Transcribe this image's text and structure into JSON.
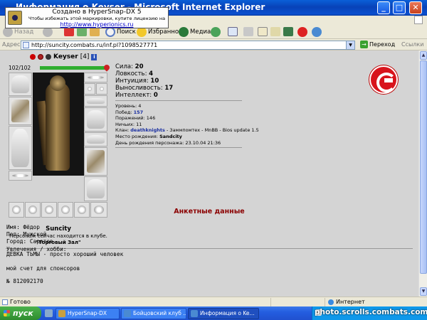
{
  "window": {
    "title": "Информация о Keyser - Microsoft Internet Explorer",
    "minimize": "_",
    "maximize": "□",
    "close": "✕"
  },
  "watermark": {
    "line1": "Создано в HyperSnap-DX 5",
    "line2": "Чтобы избежать этой маркировки, купите лицензию на",
    "line3": "http://www.hyperionics.ru"
  },
  "toolbar": {
    "back": "Назад",
    "search": "Поиск",
    "favorites": "Избранное",
    "media": "Медиа"
  },
  "address": {
    "label": "Адрес:",
    "url": "http://suncity.combats.ru/inf.pl?1098527771",
    "go": "Переход",
    "links": "Ссылки"
  },
  "character": {
    "name": "Keyser",
    "level": "[4]",
    "hp": "102/102",
    "hp_fraction": 1.0,
    "city": "Suncity",
    "location_note": "Персонаж сейчас находится в клубе.",
    "location": "\"Торговый Зал\""
  },
  "stats": [
    {
      "label": "Сила:",
      "value": "20"
    },
    {
      "label": "Ловкость:",
      "value": "4"
    },
    {
      "label": "Интуиция:",
      "value": "10"
    },
    {
      "label": "Выносливость:",
      "value": "17"
    },
    {
      "label": "Интеллект:",
      "value": "0"
    }
  ],
  "details": {
    "level_label": "Уровень:",
    "level": "4",
    "wins_label": "Побед:",
    "wins": "157",
    "losses_label": "Поражений:",
    "losses": "146",
    "draws_label": "Ничьих:",
    "draws": "11",
    "clan_label": "Клан:",
    "clan": "deathknights",
    "clan_rest": "- Заммпомтех - MnBB - Bios update 1.5",
    "birthplace_label": "Место рождения:",
    "birthplace": "Sandcity",
    "birthday_label": "День рождения персонажа:",
    "birthday": "23.10.04 21:36"
  },
  "anketa": {
    "title": "Анкетные данные",
    "name": "Имя: Фёдор",
    "gender": "Пол: Мужской",
    "city": "Город: Саратов",
    "hobby_label": "Увлечения / хобби:",
    "hobby": "ДЕВКА ТЬМЫ - просто хороший человек",
    "sponsor": "мой счет для спонсоров",
    "account": "№ 812092170"
  },
  "status": {
    "ready": "Готово",
    "zone": "Интернет"
  },
  "taskbar": {
    "start": "пуск",
    "tasks": [
      "HyperSnap-DX",
      "Бойцовский клуб ...",
      "Информация о Ke..."
    ],
    "corner_watermark": "photo.scrolls.combats.com"
  },
  "colors": {
    "title_bar": "#0842b8",
    "page_bg": "#d4d4d4",
    "anketa_title": "#8b0000",
    "emblem": "#d8141c",
    "hp_bar": "#2fae2f"
  }
}
